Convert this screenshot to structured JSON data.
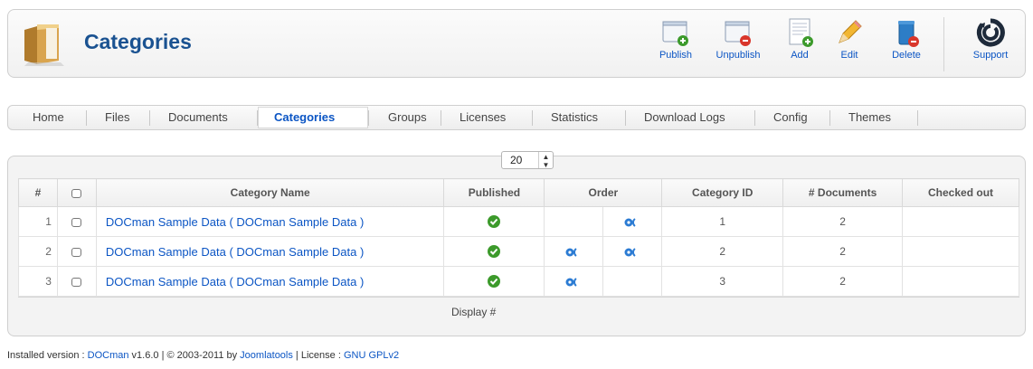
{
  "header": {
    "title": "Categories",
    "icon": "folder-icon"
  },
  "toolbar": {
    "publish": "Publish",
    "unpublish": "Unpublish",
    "add": "Add",
    "edit": "Edit",
    "delete": "Delete",
    "support": "Support"
  },
  "submenu": [
    "Home",
    "Files",
    "Documents",
    "Categories",
    "Groups",
    "Licenses",
    "Statistics",
    "Download Logs",
    "Config",
    "Themes"
  ],
  "submenu_active": "Categories",
  "table": {
    "headers": {
      "num": "#",
      "name": "Category Name",
      "published": "Published",
      "order": "Order",
      "id": "Category ID",
      "docs": "# Documents",
      "checked": "Checked out"
    },
    "rows": [
      {
        "num": "1",
        "name": "DOCman Sample Data ( DOCman Sample Data )",
        "published": true,
        "order_up": false,
        "order_down": true,
        "id": "1",
        "docs": "2",
        "checked": ""
      },
      {
        "num": "2",
        "name": "DOCman Sample Data ( DOCman Sample Data )",
        "published": true,
        "order_up": true,
        "order_down": true,
        "id": "2",
        "docs": "2",
        "checked": ""
      },
      {
        "num": "3",
        "name": "DOCman Sample Data ( DOCman Sample Data )",
        "published": true,
        "order_up": true,
        "order_down": false,
        "id": "3",
        "docs": "2",
        "checked": ""
      }
    ]
  },
  "pagination": {
    "display_label": "Display #",
    "display_value": "20"
  },
  "footer": {
    "prefix": "Installed version : ",
    "product": "DOCman",
    "version_text": " v1.6.0 | © 2003-2011 by ",
    "company": "Joomlatools",
    "license_text": " | License : ",
    "license": "GNU GPLv2"
  },
  "colors": {
    "link": "#0b55c4",
    "title": "#1a5291",
    "published_green": "#3c9a2b"
  }
}
